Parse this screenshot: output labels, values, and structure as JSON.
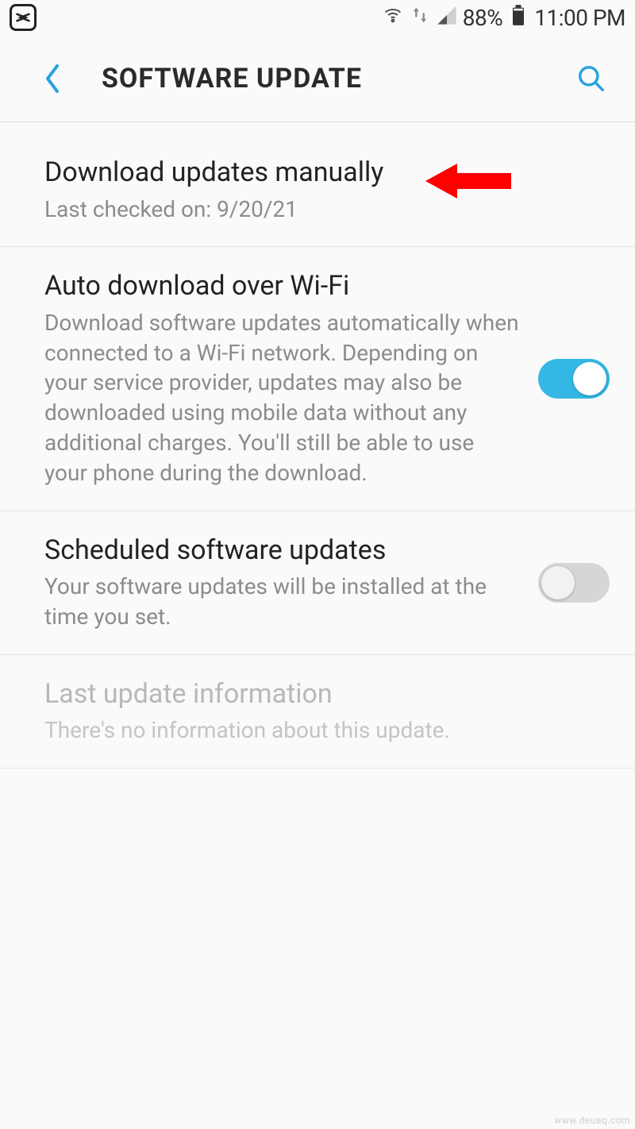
{
  "status": {
    "battery": "88%",
    "time": "11:00 PM"
  },
  "header": {
    "title": "SOFTWARE UPDATE"
  },
  "rows": {
    "download": {
      "title": "Download updates manually",
      "sub": "Last checked on: 9/20/21"
    },
    "auto": {
      "title": "Auto download over Wi-Fi",
      "sub": "Download software updates automatically when connected to a Wi-Fi network. Depending on your service provider, updates may also be downloaded using mobile data without any additional charges. You'll still be able to use your phone during the download.",
      "toggle": true
    },
    "scheduled": {
      "title": "Scheduled software updates",
      "sub": "Your software updates will be installed at the time you set.",
      "toggle": false
    },
    "lastinfo": {
      "title": "Last update information",
      "sub": "There's no information about this update."
    }
  },
  "watermark": "www.deuaq.com"
}
